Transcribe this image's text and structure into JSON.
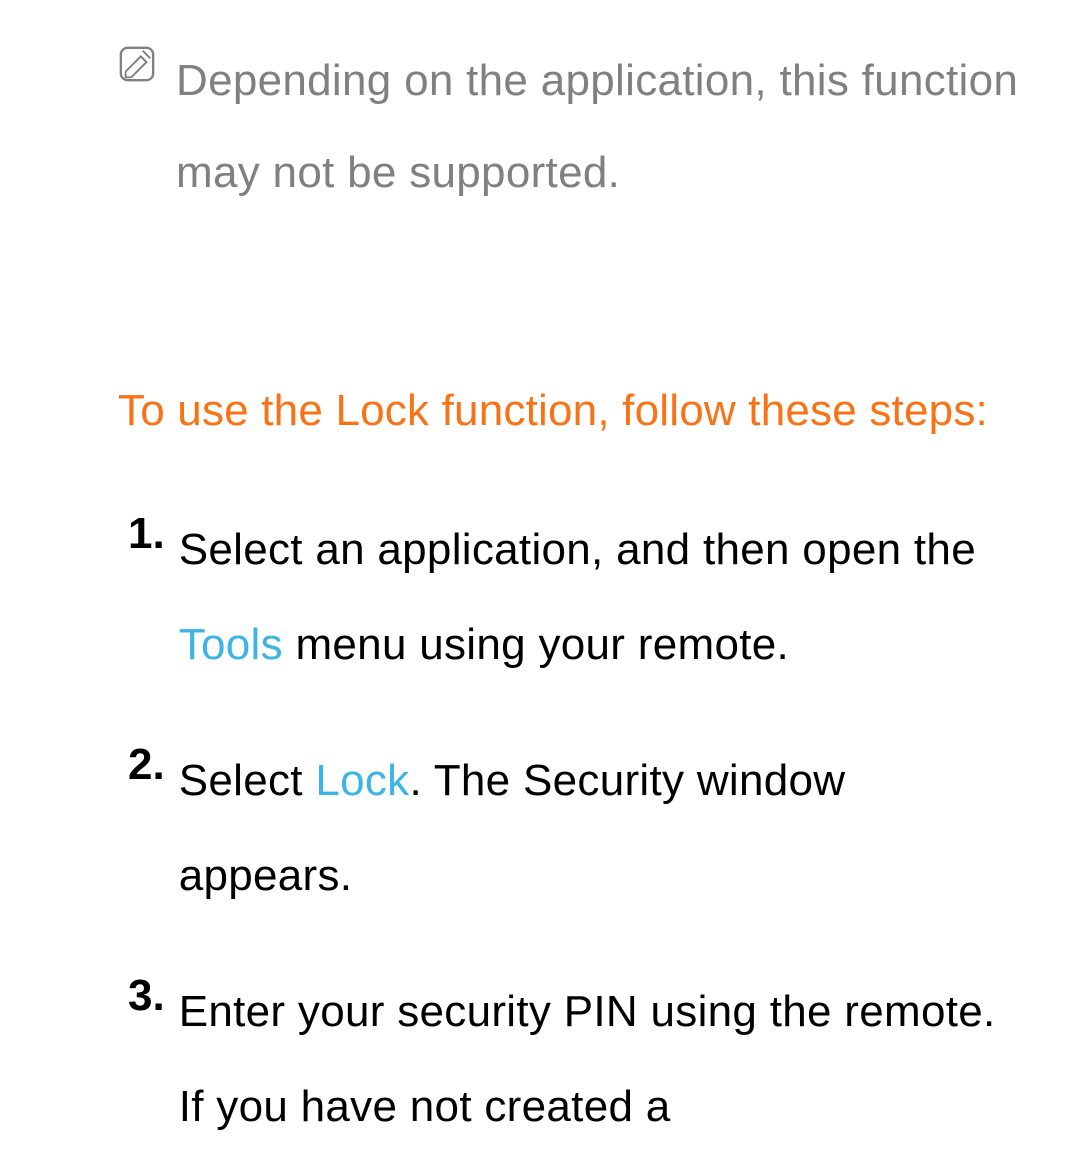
{
  "note": {
    "text": "Depending on the application, this function may not be supported."
  },
  "heading": "To use the Lock function, follow these steps:",
  "steps": [
    {
      "number": "1.",
      "parts": {
        "before": "Select an application, and then open the ",
        "highlight": "Tools",
        "after": " menu using your remote."
      }
    },
    {
      "number": "2.",
      "parts": {
        "before": "Select ",
        "highlight": "Lock",
        "after": ". The Security window appears."
      }
    },
    {
      "number": "3.",
      "parts": {
        "before": "Enter your security PIN using the remote. If you have not created a",
        "highlight": "",
        "after": ""
      }
    }
  ]
}
